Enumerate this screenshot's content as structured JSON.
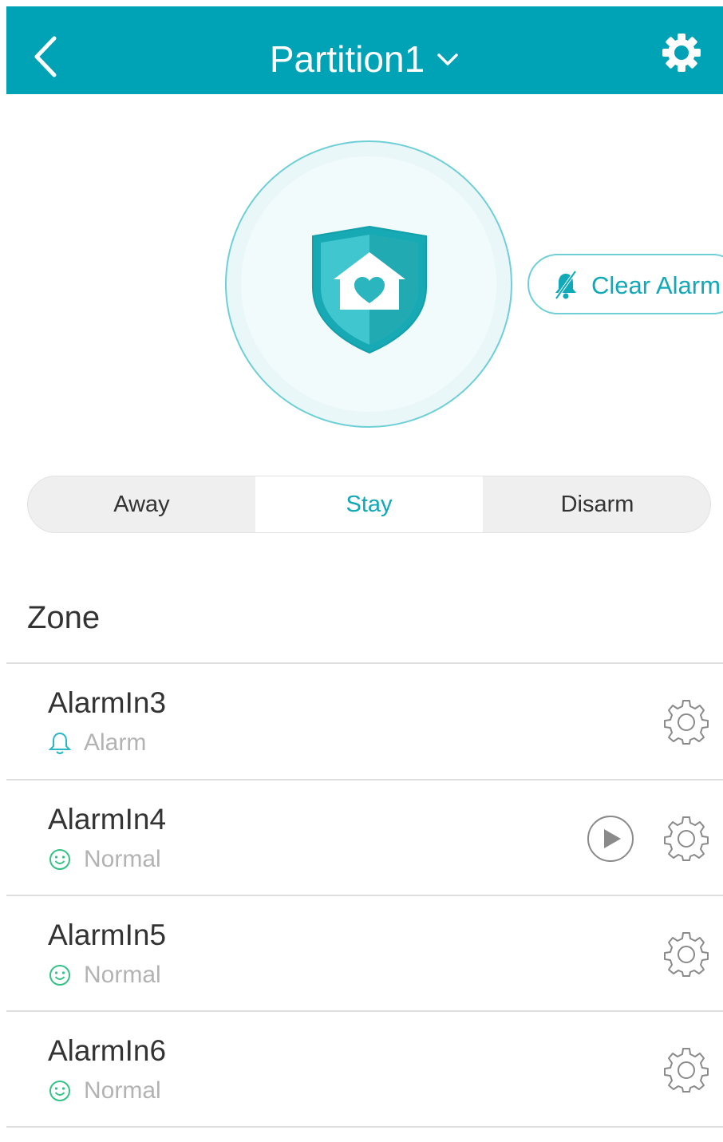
{
  "header": {
    "title": "Partition1",
    "icons": [
      "back-arrow-icon",
      "chevron-down-icon",
      "gear-icon"
    ]
  },
  "status": {
    "icon": "shield-home-heart-icon",
    "clear_alarm_label": "Clear Alarm",
    "clear_alarm_icon": "bell-muted-icon"
  },
  "modes": {
    "options": [
      "Away",
      "Stay",
      "Disarm"
    ],
    "selected": "Stay"
  },
  "zones": {
    "heading": "Zone",
    "items": [
      {
        "name": "AlarmIn3",
        "status": "Alarm",
        "status_icon": "bell-icon",
        "has_play": false
      },
      {
        "name": "AlarmIn4",
        "status": "Normal",
        "status_icon": "smiley-icon",
        "has_play": true
      },
      {
        "name": "AlarmIn5",
        "status": "Normal",
        "status_icon": "smiley-icon",
        "has_play": false
      },
      {
        "name": "AlarmIn6",
        "status": "Normal",
        "status_icon": "smiley-icon",
        "has_play": false
      }
    ]
  },
  "colors": {
    "header": "#00a3b5",
    "accent": "#10a8b8",
    "normal": "#34c287",
    "muted": "#b3b3b3"
  }
}
